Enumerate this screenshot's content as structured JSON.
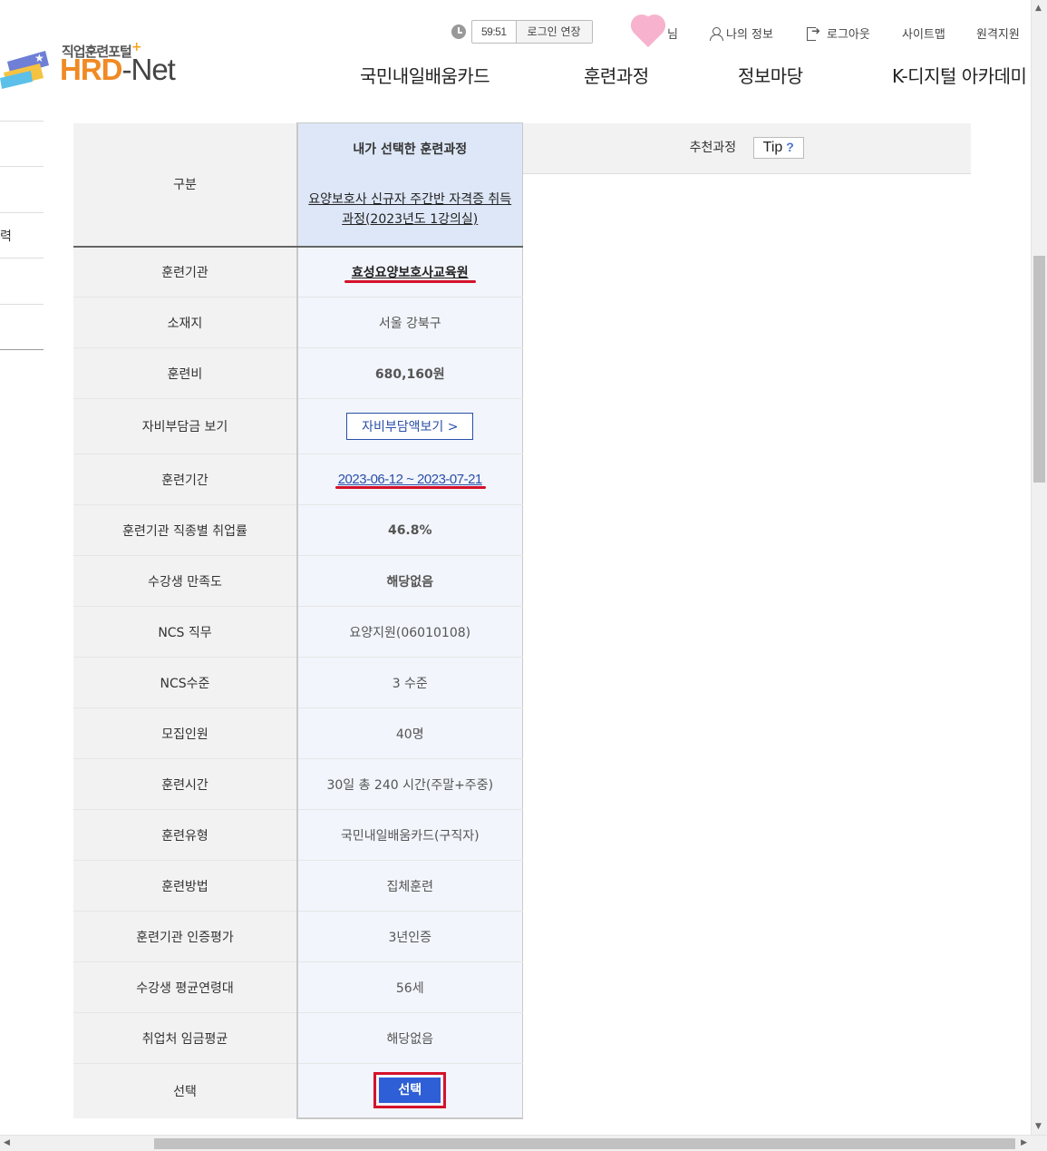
{
  "header": {
    "tagline": "직업훈련포털",
    "brand_hrd": "HRD",
    "brand_dash": "-",
    "brand_net": "Net",
    "timer": "59:51",
    "extend_label": "로그인 연장",
    "user_suffix": "님",
    "my_info": "나의 정보",
    "logout": "로그아웃",
    "sitemap": "사이트맵",
    "remote": "원격지원"
  },
  "gnb": [
    "국민내일배움카드",
    "훈련과정",
    "정보마당",
    "K-디지털 아카데미"
  ],
  "sidebar": {
    "partial_label": "력"
  },
  "compare": {
    "category_label": "구분",
    "selected_header": "내가 선택한 훈련과정",
    "recommended_header": "추천과정",
    "tip_label": "Tip",
    "tip_mark": "?",
    "course_title": "요양보호사 신규자 주간반 자격증 취득과정(2023년도 1강의실)",
    "rows": [
      {
        "label": "훈련기관",
        "value": "효성요양보호사교육원"
      },
      {
        "label": "소재지",
        "value": "서울 강북구"
      },
      {
        "label": "훈련비",
        "value": "680,160원"
      },
      {
        "label": "자비부담금 보기",
        "value": "자비부담액보기 >"
      },
      {
        "label": "훈련기간",
        "value": "2023-06-12 ~ 2023-07-21"
      },
      {
        "label": "훈련기관 직종별 취업률",
        "value": "46.8%"
      },
      {
        "label": "수강생 만족도",
        "value": "해당없음"
      },
      {
        "label": "NCS 직무",
        "value": "요양지원(06010108)"
      },
      {
        "label": "NCS수준",
        "value": "3 수준"
      },
      {
        "label": "모집인원",
        "value": "40명"
      },
      {
        "label": "훈련시간",
        "value": "30일 총 240 시간(주말+주중)"
      },
      {
        "label": "훈련유형",
        "value": "국민내일배움카드(구직자)"
      },
      {
        "label": "훈련방법",
        "value": "집체훈련"
      },
      {
        "label": "훈련기관 인증평가",
        "value": "3년인증"
      },
      {
        "label": "수강생 평균연령대",
        "value": "56세"
      },
      {
        "label": "취업처 임금평균",
        "value": "해당없음"
      },
      {
        "label": "선택",
        "value": "선택"
      }
    ]
  },
  "colors": {
    "accent_orange": "#e06b1a",
    "link_blue": "#2a4fa8",
    "button_blue": "#2f5fd6",
    "highlight_red": "#d4122b"
  }
}
